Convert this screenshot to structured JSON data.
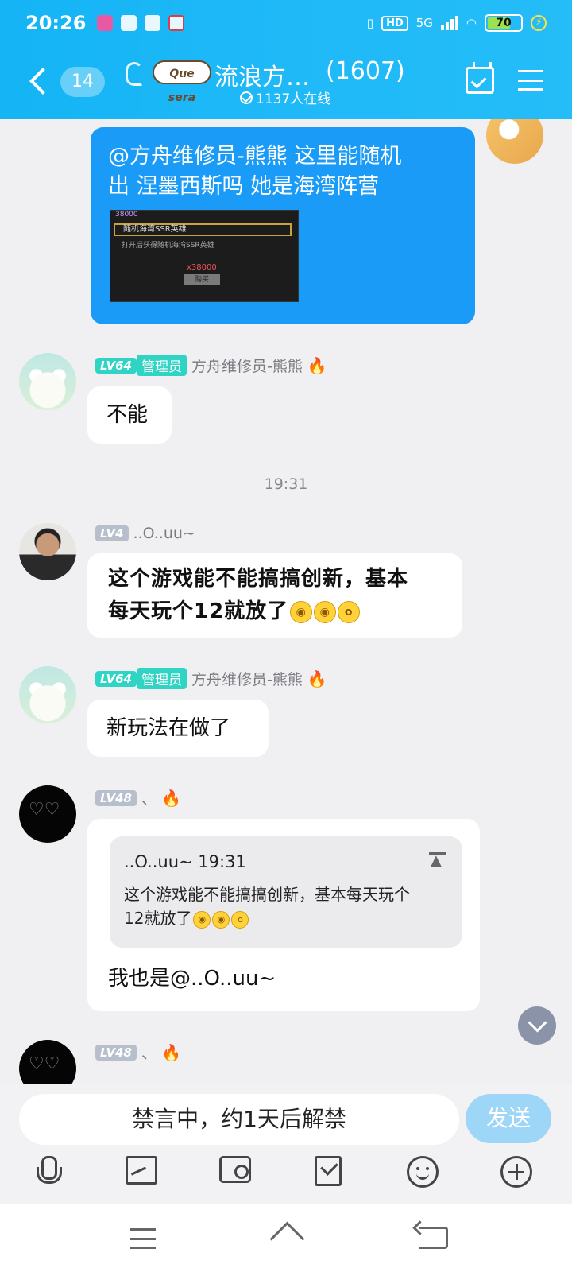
{
  "status_bar": {
    "time": "20:26",
    "hd": "HD",
    "network": "5G",
    "battery_percent": 70,
    "battery_label": "70"
  },
  "header": {
    "unread_count": "14",
    "badge_text": "Que sera",
    "group_name": "流浪方…",
    "member_count": "(1607)",
    "online_text": "1137人在线"
  },
  "messages": [
    {
      "type": "sent",
      "text_line1": "@方舟维修员-熊熊 这里能随机",
      "text_line2": "出 涅墨西斯吗  她是海湾阵营",
      "image": {
        "top_label": "38000",
        "row_label": "随机海湾SSR英雄",
        "sub_label": "打开后获得随机海湾SSR英雄",
        "price": "x38000",
        "buy": "购买"
      }
    },
    {
      "level": "LV64",
      "role": "管理员",
      "sender": "方舟维修员-熊熊",
      "text": "不能"
    },
    {
      "type": "timestamp",
      "text": "19:31"
    },
    {
      "level": "LV4",
      "sender": "..O..uu~",
      "text_line1": "这个游戏能不能搞搞创新，基本",
      "text_line2": "每天玩个12就放了"
    },
    {
      "level": "LV64",
      "role": "管理员",
      "sender": "方舟维修员-熊熊",
      "text": "新玩法在做了"
    },
    {
      "level": "LV48",
      "sender": "、",
      "quote": {
        "head": "..O..uu~ 19:31",
        "text_line1": "这个游戏能不能搞搞创新，基本每天玩个",
        "text_line2": "12就放了"
      },
      "text": "我也是@..O..uu~"
    },
    {
      "level": "LV48",
      "sender": "、"
    }
  ],
  "input": {
    "muted_text": "禁言中，约1天后解禁",
    "send_label": "发送"
  },
  "colors": {
    "header_blue": "#1fb9f8",
    "sent_bubble": "#1b9bf8",
    "admin_tag": "#2fd4c4"
  }
}
